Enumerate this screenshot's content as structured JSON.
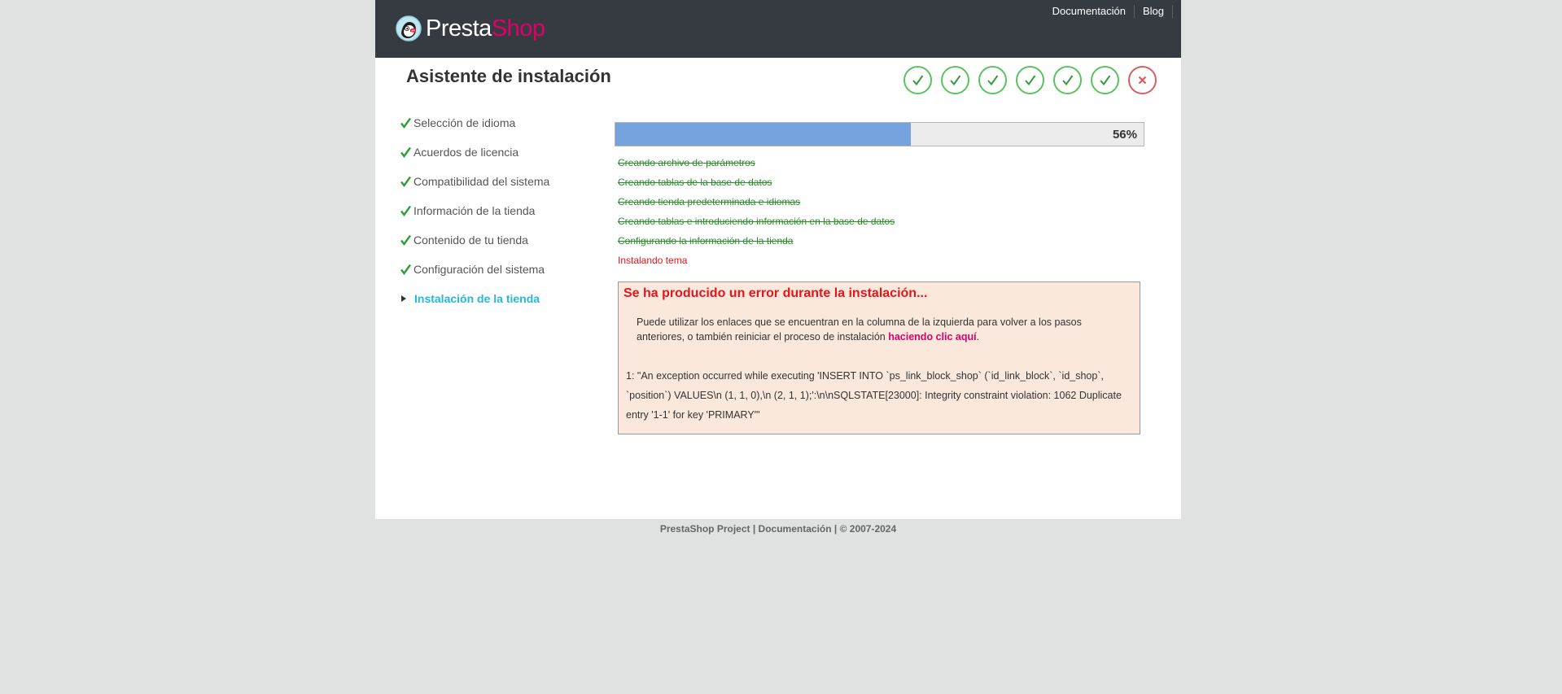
{
  "header": {
    "logo_text_1": "Presta",
    "logo_text_2": "Shop",
    "links": [
      "Documentación",
      "Blog"
    ]
  },
  "page_title": "Asistente de instalación",
  "step_indicators": [
    "complete",
    "complete",
    "complete",
    "complete",
    "complete",
    "complete",
    "error"
  ],
  "sidebar": {
    "items": [
      {
        "label": "Selección de idioma",
        "state": "done"
      },
      {
        "label": "Acuerdos de licencia",
        "state": "done"
      },
      {
        "label": "Compatibilidad del sistema",
        "state": "done"
      },
      {
        "label": "Información de la tienda",
        "state": "done"
      },
      {
        "label": "Contenido de tu tienda",
        "state": "done"
      },
      {
        "label": "Configuración del sistema",
        "state": "done"
      },
      {
        "label": "Instalación de la tienda",
        "state": "active"
      }
    ]
  },
  "progress": {
    "percent": 56,
    "label": "56%"
  },
  "progress_steps": [
    {
      "label": "Creando archivo de parámetros",
      "state": "done"
    },
    {
      "label": "Creando tablas de la base de datos",
      "state": "done"
    },
    {
      "label": "Creando tienda predeterminada e idiomas",
      "state": "done"
    },
    {
      "label": "Creando tablas e introduciendo información en la base de datos",
      "state": "done"
    },
    {
      "label": "Configurando la información de la tienda",
      "state": "done"
    },
    {
      "label": "Instalando tema",
      "state": "current"
    }
  ],
  "error": {
    "title": "Se ha producido un error durante la instalación...",
    "message_before": "Puede utilizar los enlaces que se encuentran en la columna de la izquierda para volver a los pasos anteriores, o también reiniciar el proceso de instalación ",
    "link_text": "haciendo clic aquí",
    "message_after": ".",
    "detail": "1: \"An exception occurred while executing 'INSERT INTO `ps_link_block_shop` (`id_link_block`, `id_shop`, `position`) VALUES\\n (1, 1, 0),\\n (2, 1, 1);':\\n\\nSQLSTATE[23000]: Integrity constraint violation: 1062 Duplicate entry '1-1' for key 'PRIMARY'\""
  },
  "footer": "PrestaShop Project | Documentación | © 2007-2024",
  "colors": {
    "header_bg": "#363a41",
    "brand_pink": "#df0067",
    "success_green": "#59c35e",
    "error_red": "#e3161c",
    "active_blue": "#25b9d7",
    "progress_fill": "#75a3dd"
  },
  "icons": {
    "done_step": "checkmark-icon",
    "active_step": "caret-right-icon",
    "indicator_ok": "check-circle-icon",
    "indicator_error": "x-circle-icon"
  }
}
